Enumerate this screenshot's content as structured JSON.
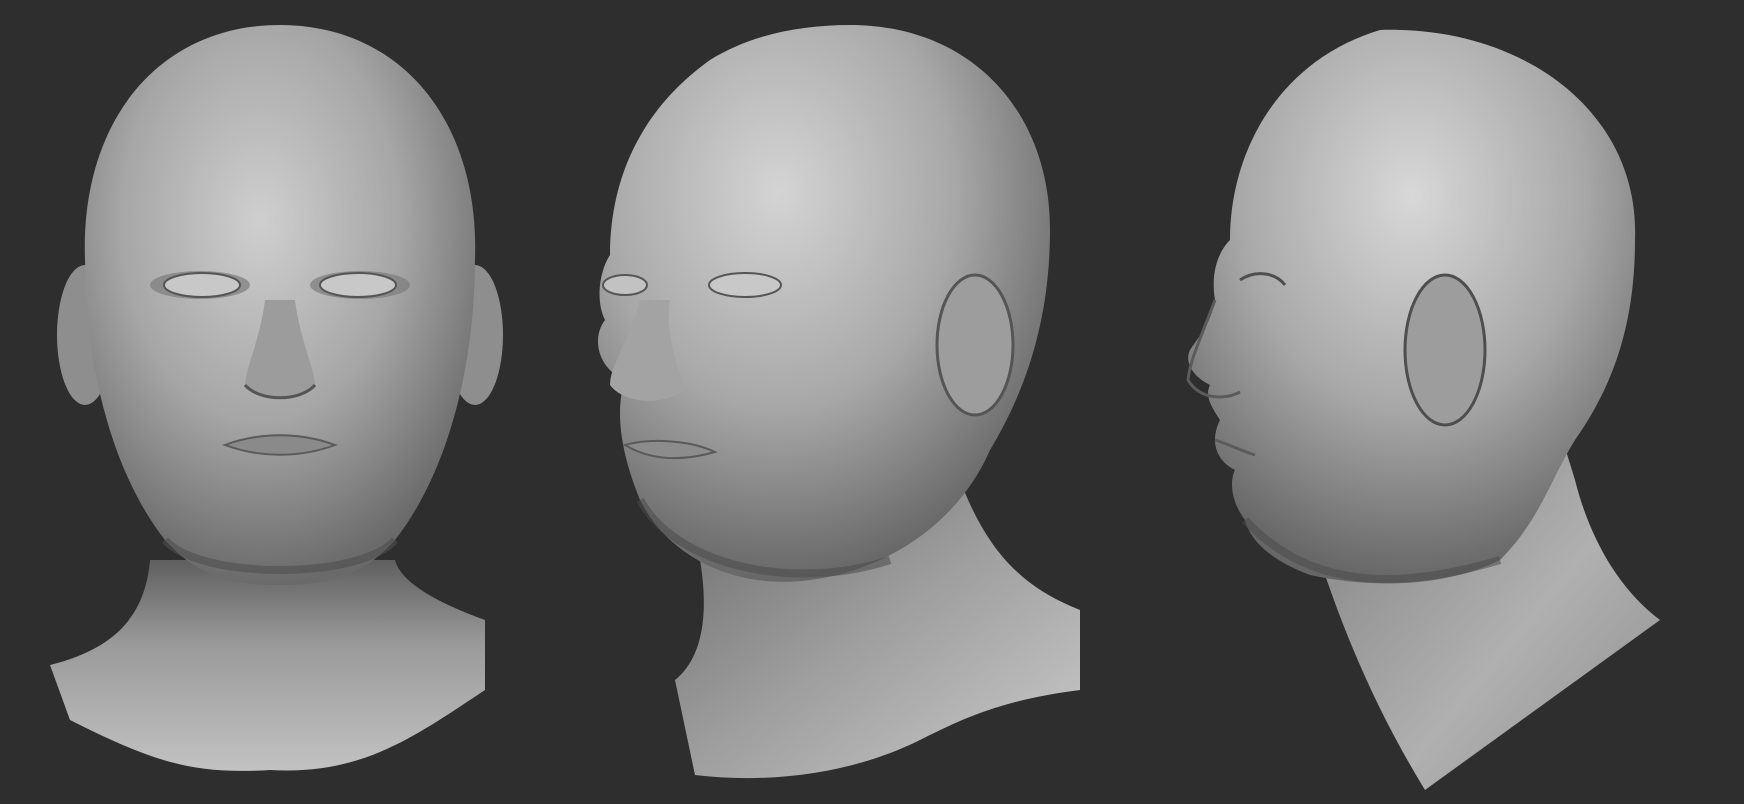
{
  "scene": {
    "background_color": "#2e2e2e",
    "material_color": "#9a9a9a",
    "views": [
      {
        "id": "front",
        "subject": "head-front-view"
      },
      {
        "id": "three-quarter",
        "subject": "head-three-quarter-view"
      },
      {
        "id": "profile",
        "subject": "head-profile-view"
      }
    ]
  }
}
